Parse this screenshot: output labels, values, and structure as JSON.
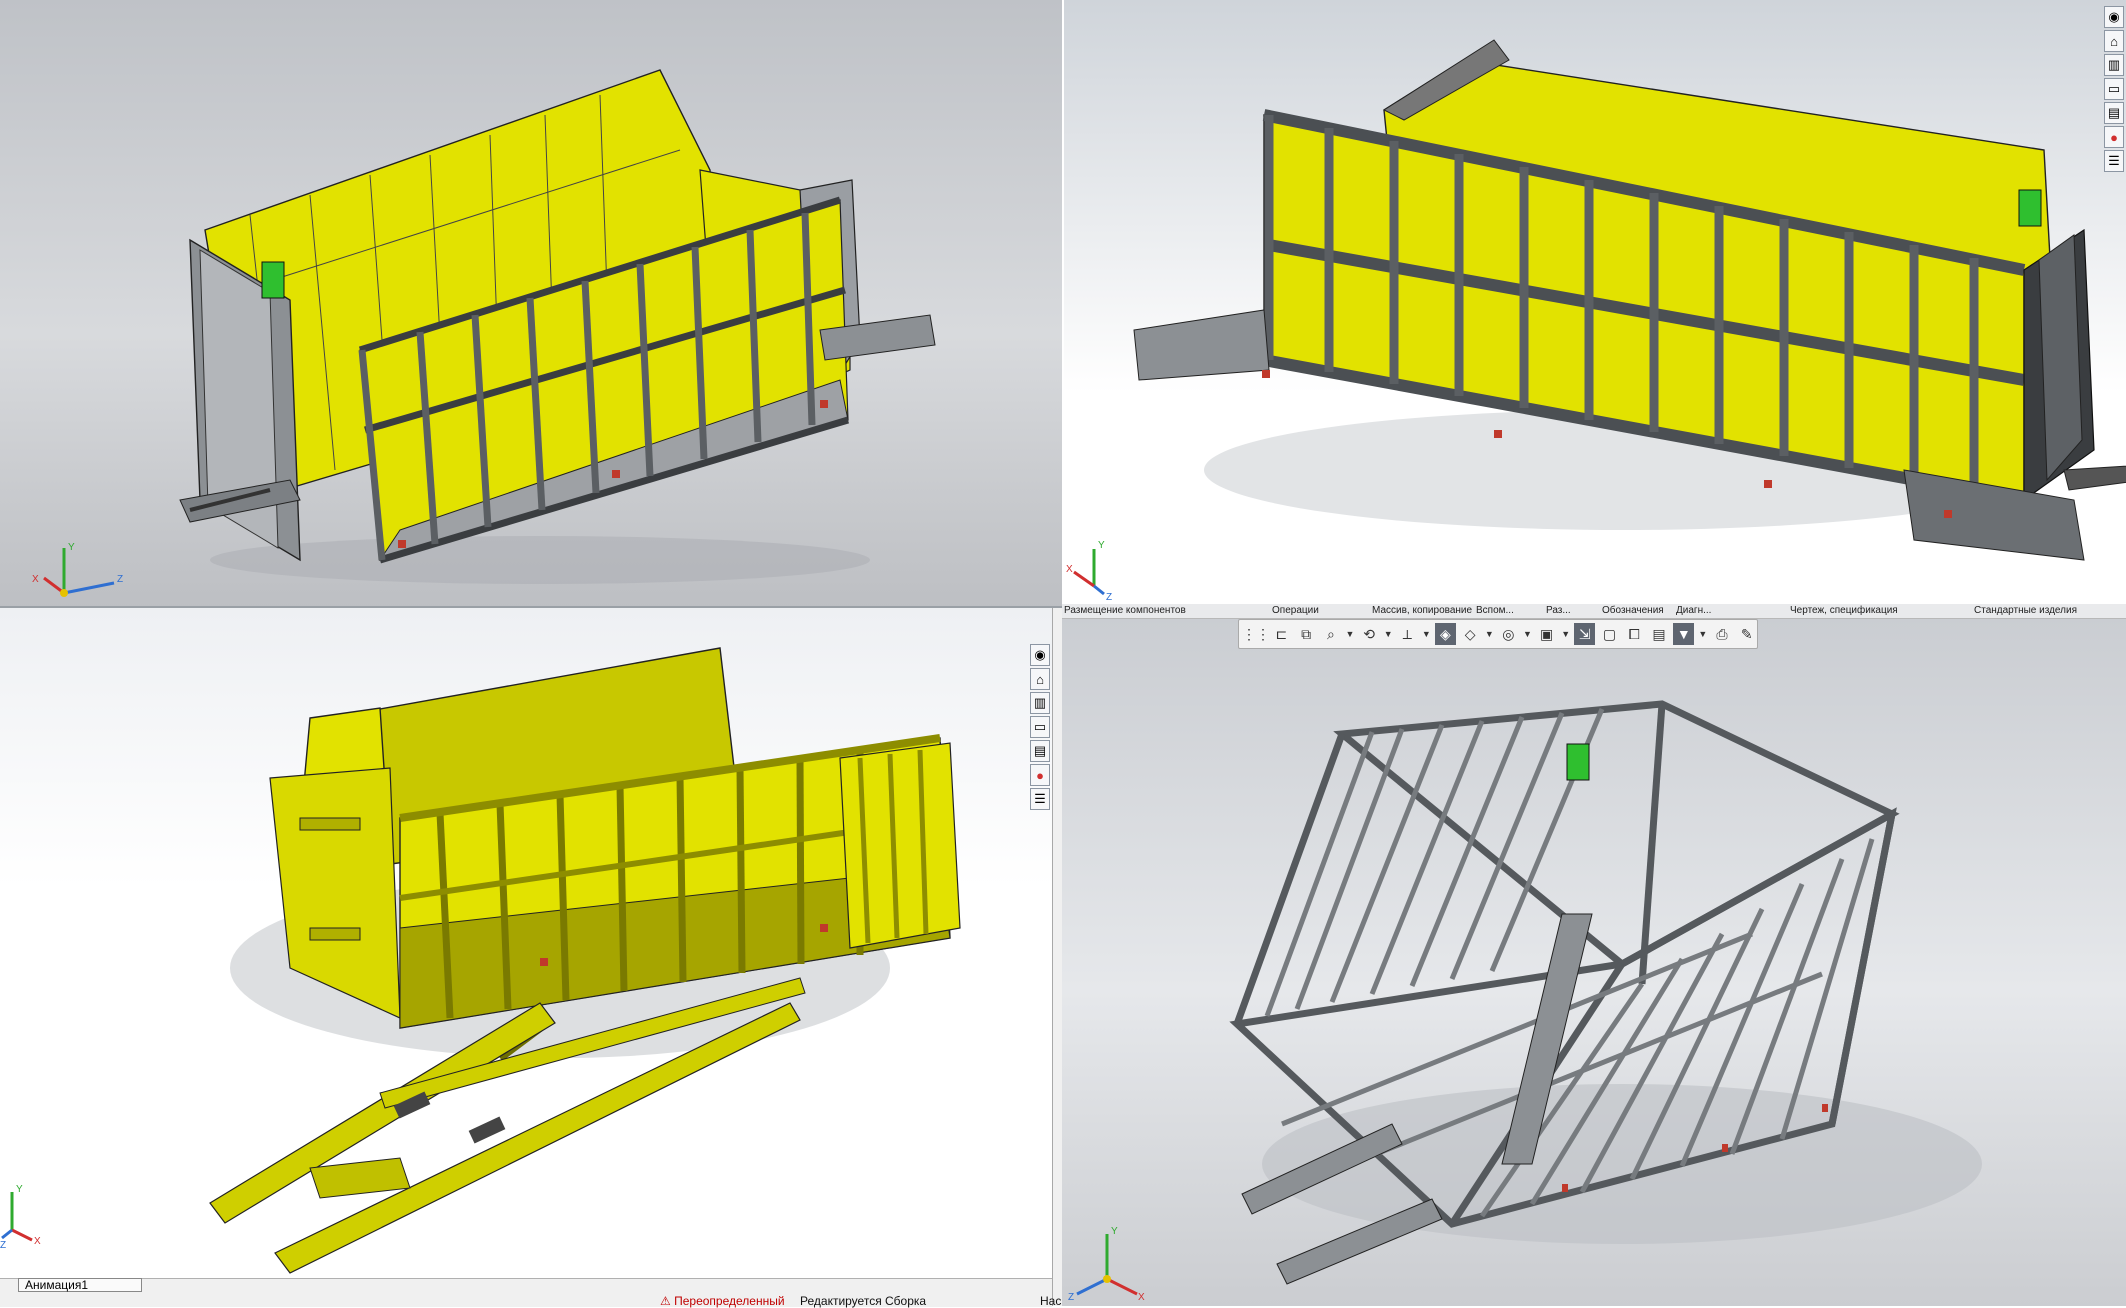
{
  "app": {
    "accent": "#2f6fd1",
    "body_yellow": "#e2e200",
    "frame_gray": "#8c9094",
    "dark_gray": "#3a3d40",
    "lime": "#d4d400"
  },
  "views": {
    "top_left": {
      "triad": {
        "x": "X",
        "y": "Y",
        "z": "Z"
      }
    },
    "top_right": {
      "triad": {
        "x": "X",
        "y": "Y",
        "z": "Z"
      }
    },
    "bottom_left": {
      "triad": {
        "x": "X",
        "y": "Y",
        "z": "Z"
      }
    },
    "bottom_right": {
      "triad": {
        "x": "X",
        "y": "Y",
        "z": "Z"
      }
    }
  },
  "command_tabs": [
    {
      "label": "Размещение компонентов"
    },
    {
      "label": "Операции"
    },
    {
      "label": "Массив, копирование"
    },
    {
      "label": "Вспом..."
    },
    {
      "label": "Раз..."
    },
    {
      "label": "Обозначения"
    },
    {
      "label": "Диагн..."
    },
    {
      "label": "Чертеж, спецификация"
    },
    {
      "label": "Стандартные изделия"
    }
  ],
  "toolbar_icons": [
    "grid-icon",
    "sketch-icon",
    "assembly-icon",
    "zoom-icon",
    "rotate-icon",
    "section-icon",
    "view-orient-icon",
    "display-style-icon",
    "hide-show-icon",
    "appearance-icon",
    "scene-icon",
    "scale-icon",
    "window-icon",
    "copy-view-icon",
    "filter-icon",
    "print-icon",
    "pencil-icon"
  ],
  "task_pane_icons": [
    "globe-icon",
    "home-icon",
    "library-icon",
    "folder-icon",
    "palette-icon",
    "color-wheel-icon",
    "list-icon"
  ],
  "status": {
    "animation_tab": "Анимация1",
    "warning": "Переопределенный",
    "editing": "Редактируется Сборка",
    "cut_label": "Нас"
  }
}
